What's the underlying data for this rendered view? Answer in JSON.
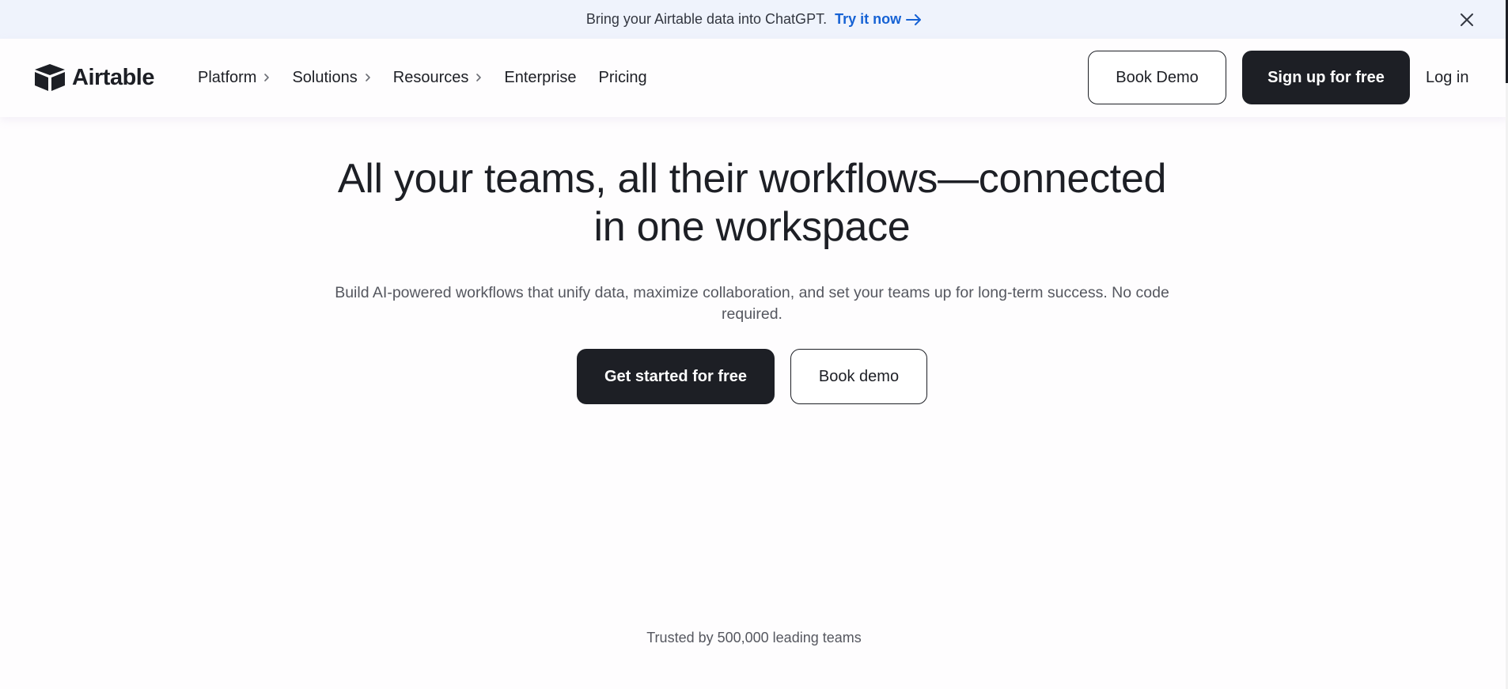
{
  "banner": {
    "text": "Bring your Airtable data into ChatGPT.",
    "link_label": "Try it now",
    "link_icon": "arrow-right-icon",
    "close_icon": "close-icon",
    "background": "#eff3fc",
    "link_color": "#1662d4"
  },
  "header": {
    "logo_text": "Airtable",
    "logo_icon": "airtable-logo-icon",
    "nav": [
      {
        "label": "Platform",
        "has_chevron": true
      },
      {
        "label": "Solutions",
        "has_chevron": true
      },
      {
        "label": "Resources",
        "has_chevron": true
      },
      {
        "label": "Enterprise",
        "has_chevron": false
      },
      {
        "label": "Pricing",
        "has_chevron": false
      }
    ],
    "book_demo_label": "Book Demo",
    "signup_label": "Sign up for free",
    "login_label": "Log in"
  },
  "hero": {
    "title_line1": "All your teams, all their workflows—connected",
    "title_line2": "in one workspace",
    "subtitle": "Build AI-powered workflows that unify data, maximize collaboration, and set your teams up for long-term success. No code required.",
    "primary_cta": "Get started for free",
    "secondary_cta": "Book demo"
  },
  "trusted_text": "Trusted by 500,000 leading teams",
  "colors": {
    "dark": "#1d1f25",
    "page_background": "#fefdfe",
    "muted_text": "#55575f"
  }
}
